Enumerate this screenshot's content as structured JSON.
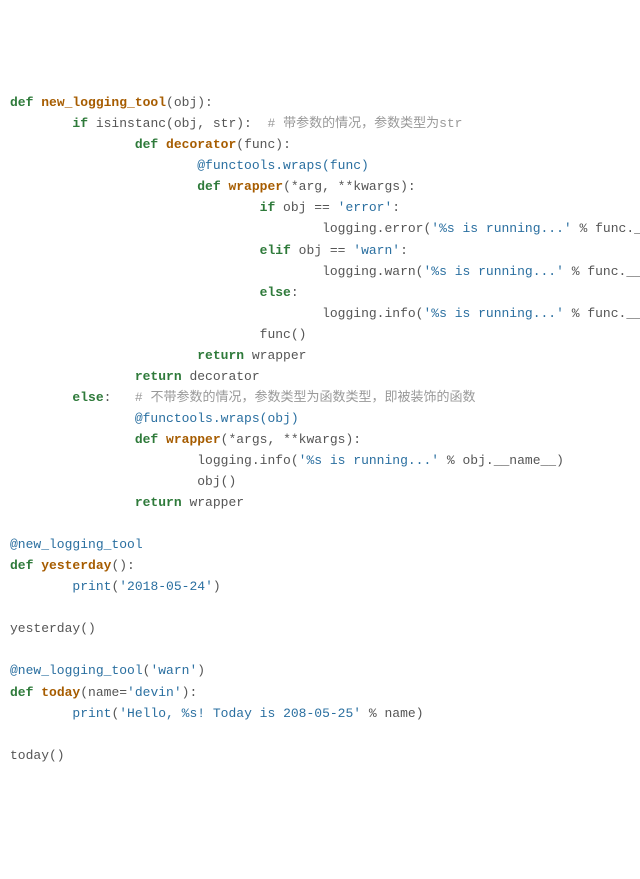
{
  "code": {
    "l1": {
      "kw1": "def",
      "fn": "new_logging_tool",
      "args": "(obj):"
    },
    "l2": {
      "kw1": "if",
      "cond": " isinstanc(obj, str):  ",
      "cm": "# 带参数的情况，参数类型为str"
    },
    "l3": {
      "kw1": "def",
      "fn": "decorator",
      "args": "(func):"
    },
    "l4": {
      "dec": "@functools.wraps(func)"
    },
    "l5": {
      "kw1": "def",
      "fn": "wrapper",
      "args": "(*arg, **kwargs):"
    },
    "l6": {
      "kw1": "if",
      "cond": " obj == ",
      "str": "'error'",
      "tail": ":"
    },
    "l7": {
      "call": "logging.error(",
      "str": "'%s is running...'",
      "mid": " % func.__name__"
    },
    "l8": {
      "kw1": "elif",
      "cond": " obj == ",
      "str": "'warn'",
      "tail": ":"
    },
    "l9": {
      "call": "logging.warn(",
      "str": "'%s is running...'",
      "mid": " % func.__name__)"
    },
    "l10": {
      "kw1": "else",
      "tail": ":"
    },
    "l11": {
      "call": "logging.info(",
      "str": "'%s is running...'",
      "mid": " % func.__name__)"
    },
    "l12": {
      "txt": "func()"
    },
    "l13": {
      "kw1": "return",
      "val": " wrapper"
    },
    "l14": {
      "kw1": "return",
      "val": " decorator"
    },
    "l15": {
      "kw1": "else",
      "tail": ":   ",
      "cm": "# 不带参数的情况，参数类型为函数类型，即被装饰的函数"
    },
    "l16": {
      "dec": "@functools.wraps(obj)"
    },
    "l17": {
      "kw1": "def",
      "fn": "wrapper",
      "args": "(*args, **kwargs):"
    },
    "l18": {
      "call": "logging.info(",
      "str": "'%s is running...'",
      "mid": " % obj.__name__)"
    },
    "l19": {
      "txt": "obj()"
    },
    "l20": {
      "kw1": "return",
      "val": " wrapper"
    },
    "l21": {
      "dec": "@new_logging_tool"
    },
    "l22": {
      "kw1": "def",
      "fn": "yesterday",
      "args": "():"
    },
    "l23": {
      "bi": "print",
      "open": "(",
      "str": "'2018-05-24'",
      "close": ")"
    },
    "l24": {
      "txt": "yesterday()"
    },
    "l25": {
      "dec": "@new_logging_tool",
      "args": "(",
      "str": "'warn'",
      "close": ")"
    },
    "l26": {
      "kw1": "def",
      "fn": "today",
      "args": "(name=",
      "str": "'devin'",
      "close": "):"
    },
    "l27": {
      "bi": "print",
      "open": "(",
      "str": "'Hello, %s! Today is 208-05-25'",
      "mid": " % name)"
    },
    "l28": {
      "txt": "today()"
    }
  }
}
